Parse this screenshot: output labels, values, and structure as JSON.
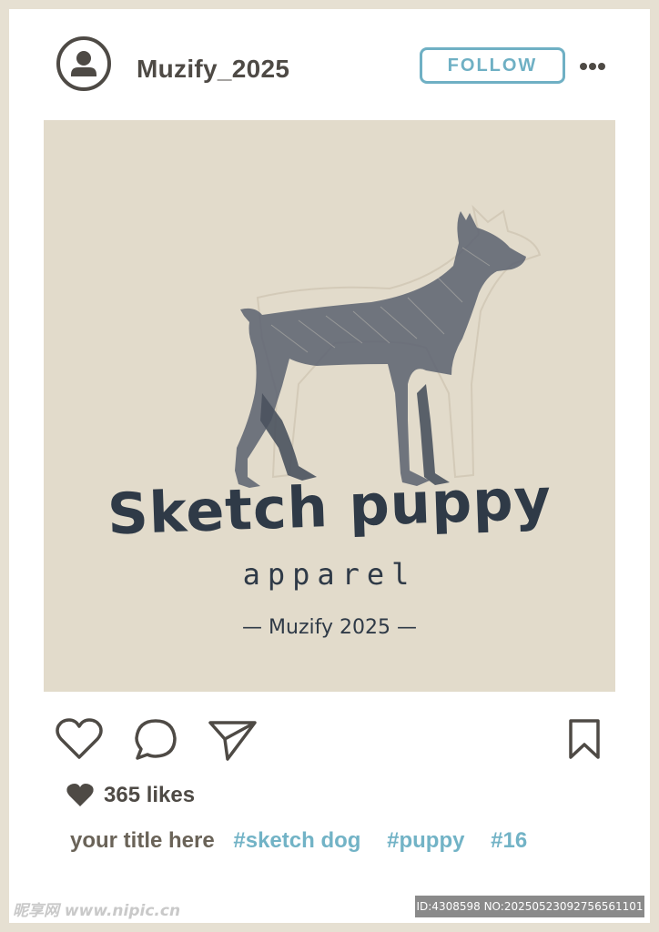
{
  "header": {
    "avatar_icon": "user-avatar-icon",
    "username": "Muzify_2025",
    "follow_label": "FOLLOW",
    "more_icon": "more-options-icon"
  },
  "post": {
    "image_title": "Sketch puppy",
    "image_subtitle": "apparel",
    "image_credit": "— Muzify 2025 —"
  },
  "actions": {
    "like_icon": "heart-icon",
    "comment_icon": "comment-icon",
    "share_icon": "send-icon",
    "save_icon": "bookmark-icon"
  },
  "likes": {
    "icon": "heart-filled-icon",
    "text": "365 likes"
  },
  "caption": {
    "title": "your title here",
    "tags": [
      "#sketch dog",
      "#puppy",
      "#16"
    ]
  },
  "watermark": {
    "site": "昵享网 www.nipic.cn",
    "id": "ID:4308598 NO:20250523092756561101"
  },
  "colors": {
    "frame": "#e6e0d2",
    "image_bg": "#e2dbcb",
    "text_dark": "#4e4a45",
    "accent_blue": "#6fb0c4",
    "ink": "#2f3a47"
  }
}
